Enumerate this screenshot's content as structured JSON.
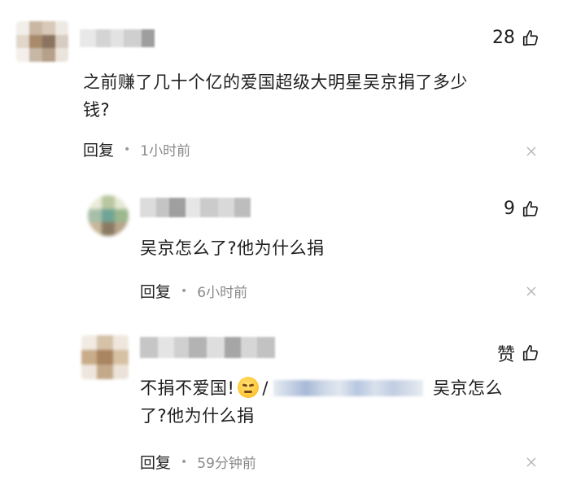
{
  "comments": [
    {
      "likes": "28",
      "text_line1": "之前赚了几十个亿的爱国超级大明星吴京捐了多少",
      "text_line2": "钱?",
      "reply_label": "回复",
      "time": "1小时前"
    },
    {
      "likes": "9",
      "text_line1": "吴京怎么了?他为什么捐",
      "reply_label": "回复",
      "time": "6小时前"
    },
    {
      "likes": "赞",
      "text_part1": "不捐不爱国!",
      "text_slash": "/",
      "text_part2": "吴京怎么",
      "text_line2": "了?他为什么捐",
      "reply_label": "回复",
      "time": "59分钟前"
    }
  ],
  "icons": {
    "like": "thumbs-up-icon",
    "close": "close-icon",
    "emoji": "angry-face-emoji"
  },
  "colors": {
    "text": "#1f1f1f",
    "meta": "#8a8a8a"
  }
}
